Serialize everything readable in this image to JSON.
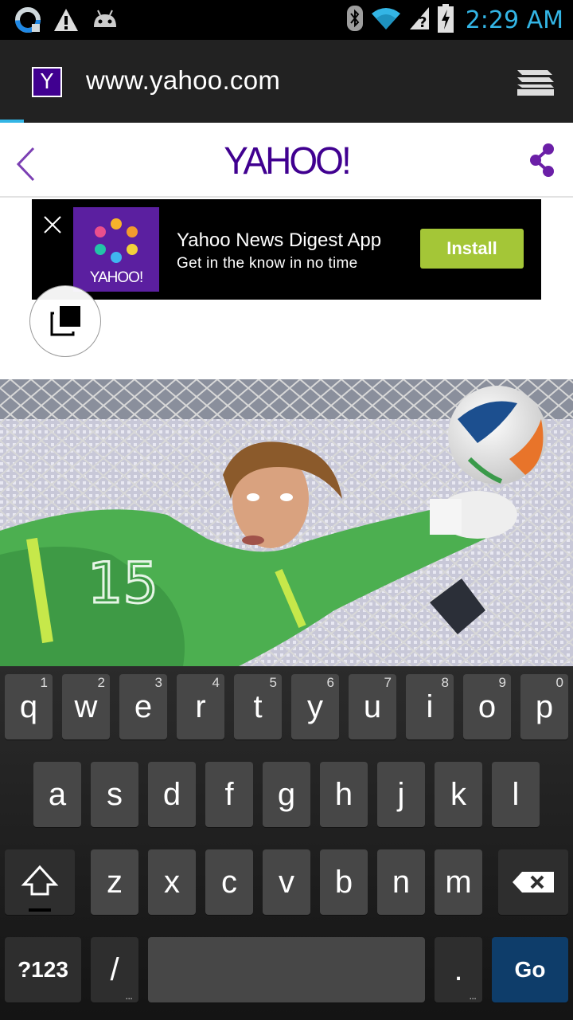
{
  "status_bar": {
    "time": "2:29 AM",
    "left_icons": [
      "sync-icon",
      "warning-icon",
      "android-icon"
    ],
    "right_icons": [
      "bluetooth-icon",
      "wifi-icon",
      "signal-icon",
      "battery-charging-icon"
    ],
    "accent": "#33b5e5"
  },
  "browser": {
    "favicon_letter": "Y",
    "url": "www.yahoo.com"
  },
  "yahoo": {
    "logo": "YAHOO!",
    "brand_color": "#400090"
  },
  "ad": {
    "icon_label": "YAHOO!",
    "title": "Yahoo News Digest App",
    "subtitle": "Get in the know in no time",
    "install_label": "Install",
    "install_color": "#a4c637"
  },
  "keyboard": {
    "row1": [
      {
        "label": "q",
        "hint": "1"
      },
      {
        "label": "w",
        "hint": "2"
      },
      {
        "label": "e",
        "hint": "3"
      },
      {
        "label": "r",
        "hint": "4"
      },
      {
        "label": "t",
        "hint": "5"
      },
      {
        "label": "y",
        "hint": "6"
      },
      {
        "label": "u",
        "hint": "7"
      },
      {
        "label": "i",
        "hint": "8"
      },
      {
        "label": "o",
        "hint": "9"
      },
      {
        "label": "p",
        "hint": "0"
      }
    ],
    "row2": [
      "a",
      "s",
      "d",
      "f",
      "g",
      "h",
      "j",
      "k",
      "l"
    ],
    "row3": [
      "z",
      "x",
      "c",
      "v",
      "b",
      "n",
      "m"
    ],
    "symbols_label": "?123",
    "slash_label": "/",
    "period_label": ".",
    "go_label": "Go",
    "go_color": "#0e3d6a"
  }
}
